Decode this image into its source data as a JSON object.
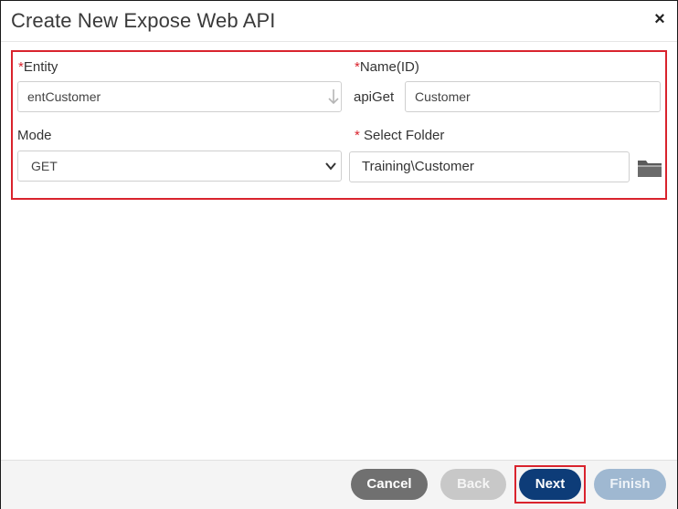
{
  "dialog": {
    "title": "Create New Expose Web API",
    "close_glyph": "×"
  },
  "form": {
    "entity": {
      "required_mark": "*",
      "label": "Entity",
      "value": "entCustomer",
      "icon": "arrow-down-icon"
    },
    "name_id": {
      "required_mark": "*",
      "label": "Name(ID)",
      "prefix": "apiGet",
      "value": "Customer"
    },
    "mode": {
      "label": "Mode",
      "value": "GET",
      "icon": "chevron-down-icon"
    },
    "select_folder": {
      "required_mark": "*",
      "label": " Select Folder",
      "value": "Training\\Customer",
      "icon": "folder-icon"
    }
  },
  "footer": {
    "cancel_label": "Cancel",
    "back_label": "Back",
    "next_label": "Next",
    "finish_label": "Finish"
  },
  "colors": {
    "highlight": "#d9232d",
    "next_button": "#0d3c78",
    "cancel_button": "#707070",
    "disabled_back": "#c8c8c8",
    "disabled_finish": "#9fb8d1"
  }
}
